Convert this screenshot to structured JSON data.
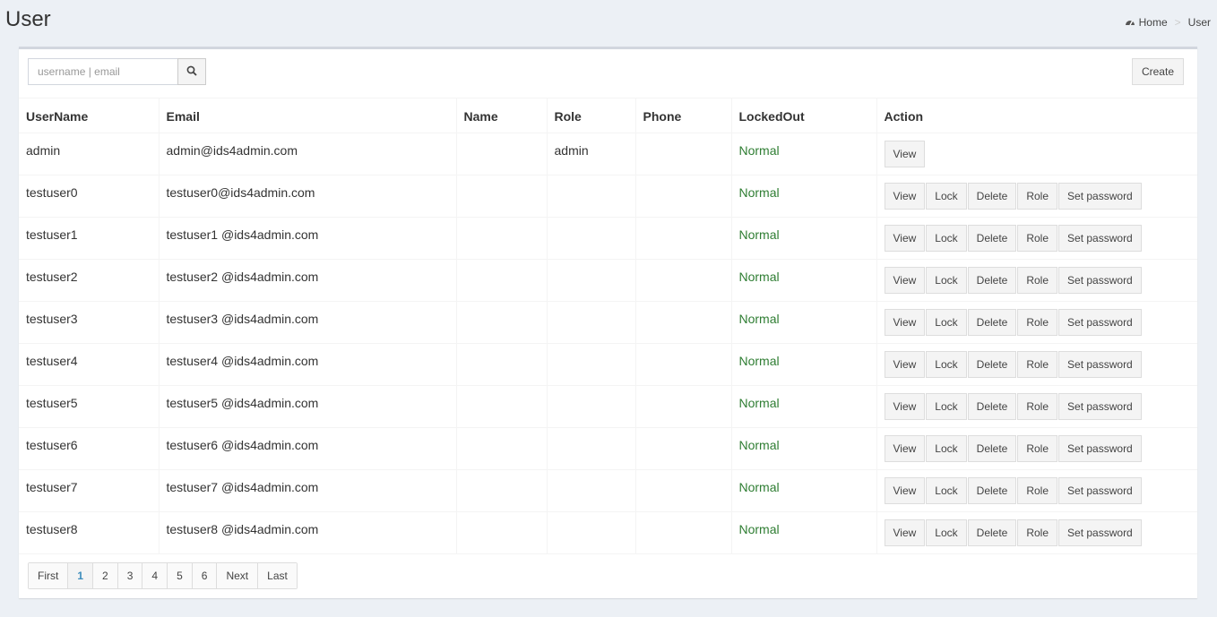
{
  "page": {
    "title": "User"
  },
  "breadcrumb": {
    "home": "Home",
    "separator": ">",
    "current": "User"
  },
  "search": {
    "placeholder": "username | email",
    "value": ""
  },
  "toolbar": {
    "create_label": "Create"
  },
  "table": {
    "columns": [
      "UserName",
      "Email",
      "Name",
      "Role",
      "Phone",
      "LockedOut",
      "Action"
    ],
    "rows": [
      {
        "username": "admin",
        "email": "admin@ids4admin.com",
        "name": "",
        "role": "admin",
        "phone": "",
        "locked_out": "Normal",
        "actions": [
          "View"
        ]
      },
      {
        "username": "testuser0",
        "email": "testuser0@ids4admin.com",
        "name": "",
        "role": "",
        "phone": "",
        "locked_out": "Normal",
        "actions": [
          "View",
          "Lock",
          "Delete",
          "Role",
          "Set password"
        ]
      },
      {
        "username": "testuser1",
        "email": "testuser1 @ids4admin.com",
        "name": "",
        "role": "",
        "phone": "",
        "locked_out": "Normal",
        "actions": [
          "View",
          "Lock",
          "Delete",
          "Role",
          "Set password"
        ]
      },
      {
        "username": "testuser2",
        "email": "testuser2 @ids4admin.com",
        "name": "",
        "role": "",
        "phone": "",
        "locked_out": "Normal",
        "actions": [
          "View",
          "Lock",
          "Delete",
          "Role",
          "Set password"
        ]
      },
      {
        "username": "testuser3",
        "email": "testuser3 @ids4admin.com",
        "name": "",
        "role": "",
        "phone": "",
        "locked_out": "Normal",
        "actions": [
          "View",
          "Lock",
          "Delete",
          "Role",
          "Set password"
        ]
      },
      {
        "username": "testuser4",
        "email": "testuser4 @ids4admin.com",
        "name": "",
        "role": "",
        "phone": "",
        "locked_out": "Normal",
        "actions": [
          "View",
          "Lock",
          "Delete",
          "Role",
          "Set password"
        ]
      },
      {
        "username": "testuser5",
        "email": "testuser5 @ids4admin.com",
        "name": "",
        "role": "",
        "phone": "",
        "locked_out": "Normal",
        "actions": [
          "View",
          "Lock",
          "Delete",
          "Role",
          "Set password"
        ]
      },
      {
        "username": "testuser6",
        "email": "testuser6 @ids4admin.com",
        "name": "",
        "role": "",
        "phone": "",
        "locked_out": "Normal",
        "actions": [
          "View",
          "Lock",
          "Delete",
          "Role",
          "Set password"
        ]
      },
      {
        "username": "testuser7",
        "email": "testuser7 @ids4admin.com",
        "name": "",
        "role": "",
        "phone": "",
        "locked_out": "Normal",
        "actions": [
          "View",
          "Lock",
          "Delete",
          "Role",
          "Set password"
        ]
      },
      {
        "username": "testuser8",
        "email": "testuser8 @ids4admin.com",
        "name": "",
        "role": "",
        "phone": "",
        "locked_out": "Normal",
        "actions": [
          "View",
          "Lock",
          "Delete",
          "Role",
          "Set password"
        ]
      }
    ]
  },
  "pagination": {
    "items": [
      "First",
      "1",
      "2",
      "3",
      "4",
      "5",
      "6",
      "Next",
      "Last"
    ],
    "active": "1"
  },
  "colors": {
    "status_normal": "#2e7d32",
    "active_page": "#3c8dbc",
    "background": "#ecf0f5"
  }
}
